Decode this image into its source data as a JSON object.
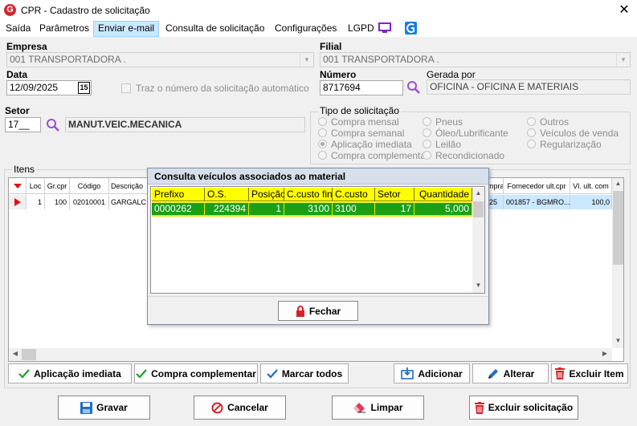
{
  "window": {
    "title": "CPR - Cadastro de solicitação",
    "logo_letter": "G",
    "close_glyph": "✕"
  },
  "menu": {
    "items": [
      "Saída",
      "Parâmetros",
      "Enviar e-mail",
      "Consulta de solicitação",
      "Configurações",
      "LGPD"
    ]
  },
  "form": {
    "empresa_label": "Empresa",
    "empresa_value": "001 TRANSPORTADORA .",
    "filial_label": "Filial",
    "filial_value": "001 TRANSPORTADORA .",
    "data_label": "Data",
    "data_value": "12/09/2025",
    "calendar_glyph": "15",
    "auto_number_label": "Traz o número da solicitação automático",
    "numero_label": "Número",
    "numero_value": "8717694",
    "gerada_label": "Gerada por",
    "gerada_value": "OFICINA - OFICINA E MATERIAIS",
    "setor_label": "Setor",
    "setor_value": "17__",
    "setor_desc": "MANUT.VEIC.MECANICA"
  },
  "tipo": {
    "title": "Tipo de solicitação",
    "options": [
      "Compra mensal",
      "Compra semanal",
      "Aplicação imediata",
      "Compra complementar",
      "Pneus",
      "Óleo/Lubrificante",
      "Leilão",
      "Recondicionado",
      "Outros",
      "Veículos de venda",
      "Regularização"
    ],
    "selected": "Aplicação imediata"
  },
  "itens": {
    "title": "Itens",
    "headers": [
      "Loc",
      "Gr.cpr",
      "Código",
      "Descrição",
      "mpra",
      "Fornecedor ult.cpr",
      "Vl. ult. com"
    ],
    "row": {
      "loc": "1",
      "grcpr": "100",
      "codigo": "02010001",
      "descricao": "GARGALC",
      "mpra": "25",
      "fornecedor": "001857 - BGMRO...",
      "vl": "100,0"
    }
  },
  "popup": {
    "title": "Consulta veículos associados ao material",
    "headers": [
      "Prefixo",
      "O.S.",
      "Posição",
      "C.custo fin.",
      "C.custo",
      "Setor",
      "Quantidade"
    ],
    "row": [
      "0000262",
      "224394",
      "1",
      "3100",
      "3100",
      "17",
      "5,000"
    ],
    "close_button": "Fechar"
  },
  "buttons": {
    "aplicacao": "Aplicação imediata",
    "complementar": "Compra complementar",
    "marcar": "Marcar todos",
    "adicionar": "Adicionar",
    "alterar": "Alterar",
    "excluir_item": "Excluir Item",
    "gravar": "Gravar",
    "cancelar": "Cancelar",
    "limpar": "Limpar",
    "excluir_solicitacao": "Excluir solicitação"
  }
}
